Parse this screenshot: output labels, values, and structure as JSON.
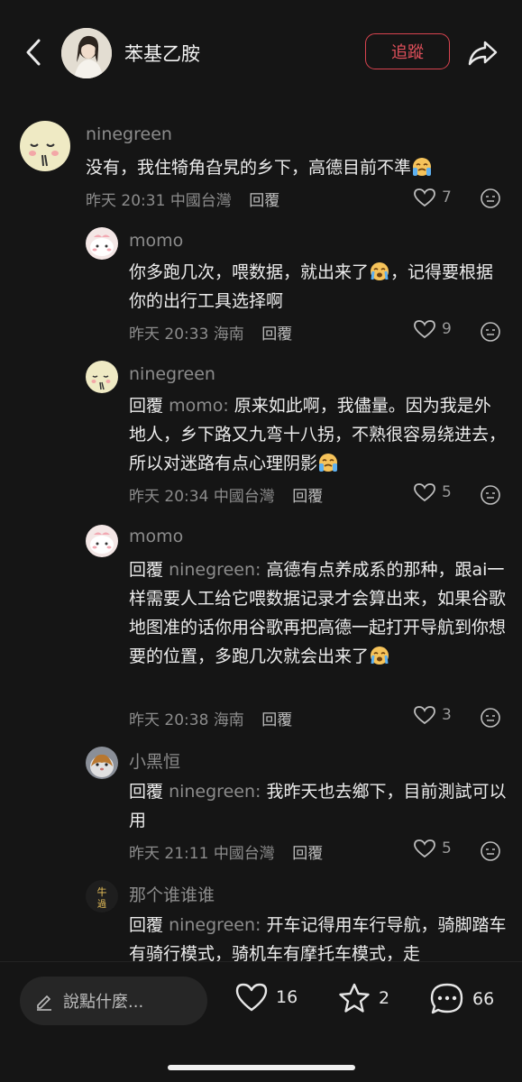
{
  "header": {
    "name": "苯基乙胺",
    "follow_label": "追蹤"
  },
  "comments": [
    {
      "name": "ninegreen",
      "text": "没有，我住犄角旮旯的乡下，高德目前不準",
      "time": "昨天 20:31",
      "location": "中國台灣",
      "reply_label": "回覆",
      "likes": "7"
    },
    {
      "name": "momo",
      "text": "你多跑几次，喂数据，就出来了",
      "text_after": "，记得要根据你的出行工具选择啊",
      "time": "昨天 20:33",
      "location": "海南",
      "reply_label": "回覆",
      "likes": "9"
    },
    {
      "name": "ninegreen",
      "prefix": "回覆",
      "target": "momo:",
      "text": "原来如此啊，我儘量。因为我是外地人，乡下路又九弯十八拐，不熟很容易绕进去，所以对迷路有点心理阴影",
      "time": "昨天 20:34",
      "location": "中國台灣",
      "reply_label": "回覆",
      "likes": "5"
    },
    {
      "name": "momo",
      "prefix": "回覆",
      "target": "ninegreen:",
      "text": "高德有点养成系的那种，跟ai一样需要人工给它喂数据记录才会算出来，如果谷歌地图准的话你用谷歌再把高德一起打开导航到你想要的位置，多跑几次就会出来了",
      "time": "昨天 20:38",
      "location": "海南",
      "reply_label": "回覆",
      "likes": "3"
    },
    {
      "name": "小黑恒",
      "prefix": "回覆",
      "target": "ninegreen:",
      "text": "我昨天也去鄉下，目前測試可以用",
      "time": "昨天 21:11",
      "location": "中國台灣",
      "reply_label": "回覆",
      "likes": "5"
    },
    {
      "name": "那个谁谁谁",
      "prefix": "回覆",
      "target": "ninegreen:",
      "text": "开车记得用车行导航，骑脚踏车有骑行模式，骑机车有摩托车模式，走"
    }
  ],
  "bottom_bar": {
    "input_placeholder": "說點什麼...",
    "likes": "16",
    "favorites": "2",
    "comments": "66"
  },
  "colors": {
    "background": "#151515",
    "accent_red": "#e0505b",
    "muted_text": "#8c8c8c"
  }
}
